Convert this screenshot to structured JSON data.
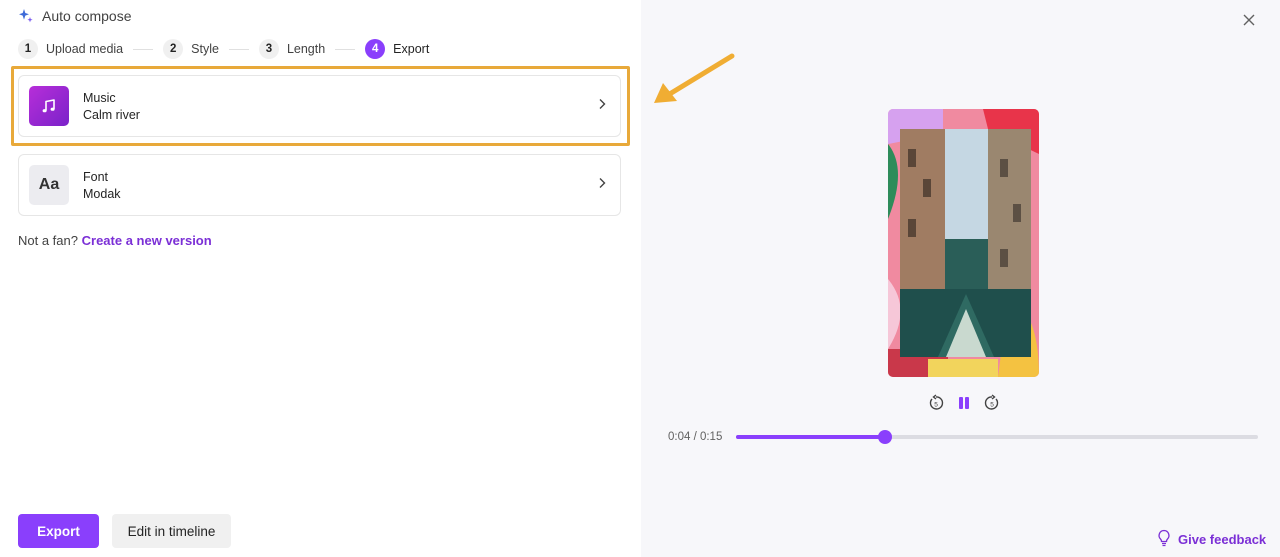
{
  "header": {
    "title": "Auto compose",
    "icon": "sparkle-icon"
  },
  "stepper": {
    "steps": [
      {
        "number": "1",
        "label": "Upload media"
      },
      {
        "number": "2",
        "label": "Style"
      },
      {
        "number": "3",
        "label": "Length"
      },
      {
        "number": "4",
        "label": "Export"
      }
    ],
    "active_step": "4"
  },
  "cards": {
    "music": {
      "title": "Music",
      "value": "Calm river",
      "icon": "music-note-icon"
    },
    "font": {
      "title": "Font",
      "value": "Modak",
      "icon_text": "Aa"
    }
  },
  "notfan": {
    "prefix": "Not a fan?",
    "link": "Create a new version"
  },
  "buttons": {
    "export": "Export",
    "edit_timeline": "Edit in timeline"
  },
  "player": {
    "time": "0:04 / 0:15",
    "progress_fraction": 0.285
  },
  "feedback": {
    "label": "Give feedback",
    "icon": "lightbulb-icon"
  },
  "colors": {
    "accent": "#8a3ffc",
    "highlight": "#e8a93a",
    "link": "#7b2fd6"
  }
}
